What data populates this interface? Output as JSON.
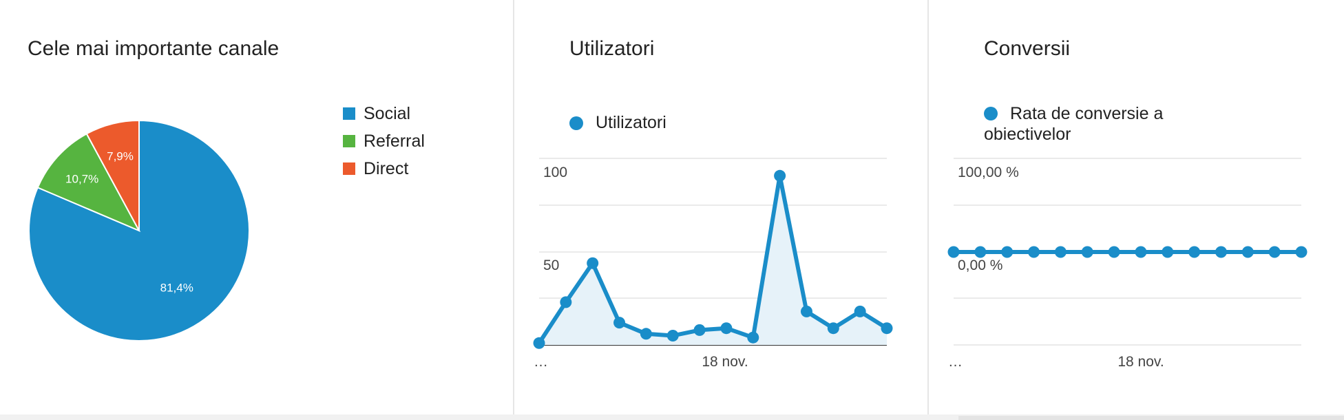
{
  "colors": {
    "social": "#1a8dc9",
    "referral": "#56b440",
    "direct": "#ec5a2c",
    "line": "#1a8dc9",
    "area": "#e6f2f9",
    "grid": "#e4e4e4"
  },
  "panels": {
    "channels": {
      "title": "Cele mai importante canale",
      "legend": [
        "Social",
        "Referral",
        "Direct"
      ]
    },
    "users": {
      "title": "Utilizatori",
      "legend": "Utilizatori"
    },
    "conversions": {
      "title": "Conversii",
      "legend_line1": "Rata de conversie a",
      "legend_line2": "obiectivelor"
    }
  },
  "chart_data": [
    {
      "type": "pie",
      "title": "Cele mai importante canale",
      "slices": [
        {
          "label": "Social",
          "value": 81.4,
          "display": "81,4%"
        },
        {
          "label": "Referral",
          "value": 10.7,
          "display": "10,7%"
        },
        {
          "label": "Direct",
          "value": 7.9,
          "display": "7,9%"
        }
      ]
    },
    {
      "type": "area",
      "title": "Utilizatori",
      "series": [
        {
          "name": "Utilizatori",
          "values": [
            1,
            23,
            44,
            12,
            6,
            5,
            8,
            9,
            4,
            91,
            18,
            9,
            18,
            9
          ]
        }
      ],
      "x_tick_labels": [
        "…",
        "18 nov."
      ],
      "y_ticks": [
        "100",
        "50"
      ],
      "ylim": [
        0,
        100
      ],
      "grid": true
    },
    {
      "type": "line",
      "title": "Conversii",
      "series": [
        {
          "name": "Rata de conversie a obiectivelor",
          "values": [
            0,
            0,
            0,
            0,
            0,
            0,
            0,
            0,
            0,
            0,
            0,
            0,
            0,
            0
          ]
        }
      ],
      "x_tick_labels": [
        "…",
        "18 nov."
      ],
      "y_ticks": [
        "100,00 %",
        "0,00 %"
      ],
      "grid": true
    }
  ]
}
